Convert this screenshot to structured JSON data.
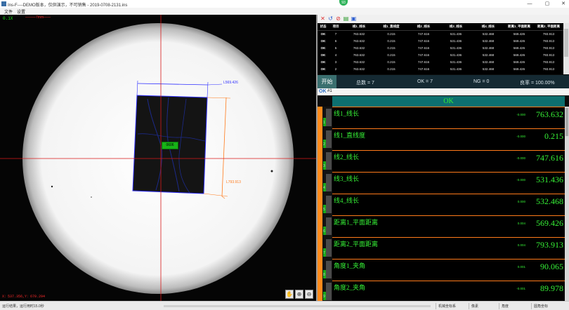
{
  "window": {
    "title": "Ins-F----DEMO版本，仅供演示，不可销售 - 2019-0708-2131.ins",
    "badge": "93",
    "controls": {
      "minimize": "—",
      "maximize": "▢",
      "close": "✕"
    }
  },
  "menu": {
    "items": [
      "文件",
      "设置"
    ]
  },
  "camera": {
    "zoom": "0.1X",
    "note": "———7mm——",
    "coords": "X：537.356,Y：670.294",
    "marker": "0606",
    "width_dim": "L569.426",
    "height_dim": "L793.913",
    "tools": [
      "hand-icon",
      "zoom-in-icon",
      "zoom-out-icon"
    ]
  },
  "toolbar": {
    "icons": [
      "delete-icon",
      "refresh-icon",
      "stop-icon",
      "export-icon",
      "save-icon"
    ],
    "colors": {
      "delete": "#e03030",
      "refresh": "#3060d0",
      "stop": "#e03030",
      "export": "#2a9a2a",
      "save": "#3060d0"
    }
  },
  "results": {
    "columns": [
      "状态",
      "项目",
      "线1_线长",
      "线1_直线度",
      "线2_线长",
      "线3_线长",
      "线4_线长",
      "距离1_平面距离",
      "距离2_平面距离"
    ],
    "rows": [
      [
        "OK",
        "7",
        "763.632",
        "0.215",
        "747.616",
        "531.436",
        "532.468",
        "569.426",
        "793.913"
      ],
      [
        "OK",
        "6",
        "763.632",
        "0.215",
        "747.616",
        "531.436",
        "532.468",
        "569.426",
        "793.913"
      ],
      [
        "OK",
        "5",
        "763.632",
        "0.215",
        "747.616",
        "531.436",
        "532.468",
        "569.426",
        "793.913"
      ],
      [
        "OK",
        "4",
        "763.632",
        "0.215",
        "747.616",
        "531.436",
        "532.468",
        "569.426",
        "793.913"
      ],
      [
        "OK",
        "3",
        "763.632",
        "0.215",
        "747.616",
        "531.436",
        "532.468",
        "569.426",
        "793.913"
      ],
      [
        "OK",
        "2",
        "763.632",
        "0.215",
        "747.616",
        "531.436",
        "532.468",
        "569.426",
        "793.913"
      ]
    ]
  },
  "stats": {
    "start": "开始",
    "total": "总数 = 7",
    "ok": "OK = 7",
    "ng": "NG = 0",
    "rate": "良率 = 100.00%"
  },
  "tab": {
    "status": "OK",
    "num": "#1"
  },
  "banner": "OK",
  "measures": [
    {
      "idx": "1",
      "name": "线1_线长",
      "tol": "-0.000",
      "value": "763.632"
    },
    {
      "idx": "2",
      "name": "线1_直线度",
      "tol": "-0.000",
      "value": "0.215"
    },
    {
      "idx": "3",
      "name": "线2_线长",
      "tol": "-0.000",
      "value": "747.616"
    },
    {
      "idx": "4",
      "name": "线3_线长",
      "tol": "-0.000",
      "value": "531.436"
    },
    {
      "idx": "5",
      "name": "线4_线长",
      "tol": "0.000",
      "value": "532.468"
    },
    {
      "idx": "6",
      "name": "距离1_平面距离",
      "tol": "0.004",
      "value": "569.426"
    },
    {
      "idx": "7",
      "name": "距离2_平面距离",
      "tol": "0.004",
      "value": "793.913"
    },
    {
      "idx": "8",
      "name": "角度1_夹角",
      "tol": "0.001",
      "value": "90.065"
    },
    {
      "idx": "9",
      "name": "角度2_夹角",
      "tol": "-0.001",
      "value": "89.978"
    }
  ],
  "status": {
    "left": "运行结果，运行用时15.0秒",
    "fields": [
      "机械坐标系",
      "像素",
      "角度",
      "圆角坐标"
    ]
  }
}
